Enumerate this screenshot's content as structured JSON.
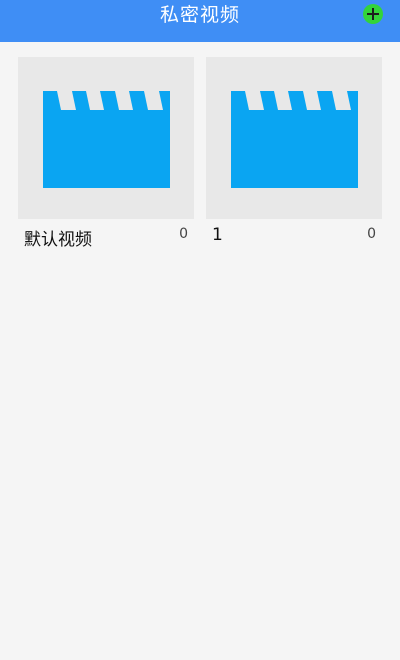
{
  "header": {
    "title": "私密视频",
    "add_icon": "plus-circle-icon",
    "background_color": "#3f8ef5"
  },
  "folders": [
    {
      "name": "默认视频",
      "count": "0",
      "icon": "clapperboard-icon"
    },
    {
      "name": "1",
      "count": "0",
      "icon": "clapperboard-icon"
    }
  ],
  "colors": {
    "clapperboard": "#0aa5f2",
    "thumb_bg": "#e8e8e8",
    "add_button": "#33d43a"
  }
}
